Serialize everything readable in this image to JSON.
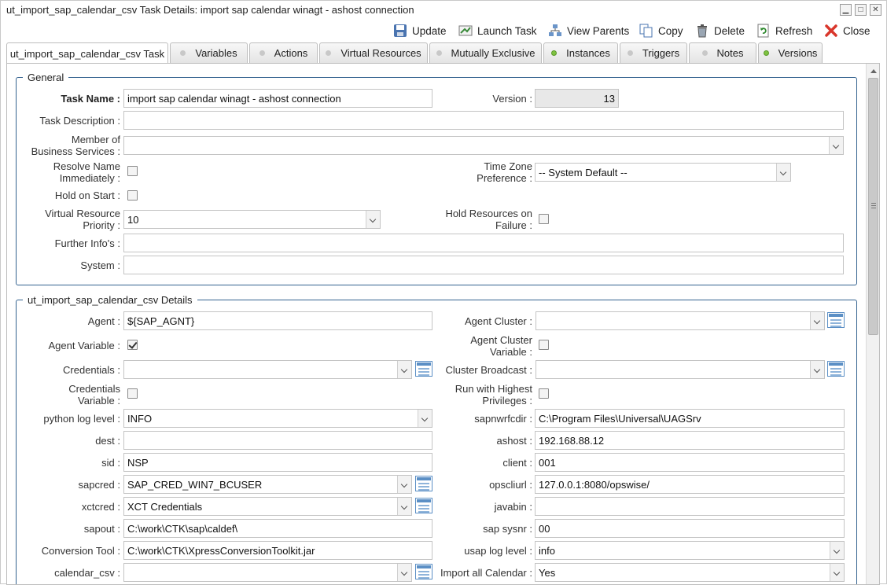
{
  "window": {
    "title": "ut_import_sap_calendar_csv Task Details: import sap calendar winagt - ashost connection",
    "controls": [
      "minimize",
      "maximize",
      "close"
    ]
  },
  "toolbar": {
    "update": "Update",
    "launch": "Launch Task",
    "view_parents": "View Parents",
    "copy": "Copy",
    "delete": "Delete",
    "refresh": "Refresh",
    "close": "Close"
  },
  "tabs": [
    {
      "label": "ut_import_sap_calendar_csv Task",
      "status": "none"
    },
    {
      "label": "Variables",
      "status": "grey"
    },
    {
      "label": "Actions",
      "status": "grey"
    },
    {
      "label": "Virtual Resources",
      "status": "grey"
    },
    {
      "label": "Mutually Exclusive",
      "status": "grey"
    },
    {
      "label": "Instances",
      "status": "green"
    },
    {
      "label": "Triggers",
      "status": "grey"
    },
    {
      "label": "Notes",
      "status": "grey"
    },
    {
      "label": "Versions",
      "status": "green"
    }
  ],
  "general": {
    "legend": "General",
    "task_name_label": "Task Name :",
    "task_name": "import sap calendar winagt - ashost connection",
    "version_label": "Version :",
    "version": "13",
    "task_description_label": "Task Description :",
    "task_description": "",
    "member_label_1": "Member of",
    "member_label_2": "Business Services :",
    "member_value": "",
    "resolve_label_1": "Resolve Name",
    "resolve_label_2": "Immediately :",
    "resolve_checked": false,
    "tz_label_1": "Time Zone",
    "tz_label_2": "Preference :",
    "tz_value": "-- System Default --",
    "hold_label": "Hold on Start :",
    "hold_checked": false,
    "vr_priority_label_1": "Virtual Resource",
    "vr_priority_label_2": "Priority :",
    "vr_priority": "10",
    "hold_res_label_1": "Hold Resources on",
    "hold_res_label_2": "Failure :",
    "hold_res_checked": false,
    "further_info_label": "Further Info's :",
    "further_info": "",
    "system_label": "System :",
    "system": ""
  },
  "details": {
    "legend": "ut_import_sap_calendar_csv Details",
    "agent_label": "Agent :",
    "agent": "${SAP_AGNT}",
    "agent_cluster_label": "Agent Cluster :",
    "agent_cluster": "",
    "agent_variable_label": "Agent Variable :",
    "agent_variable_checked": true,
    "agent_cluster_var_label_1": "Agent Cluster",
    "agent_cluster_var_label_2": "Variable :",
    "agent_cluster_var_checked": false,
    "credentials_label": "Credentials :",
    "credentials": "",
    "cluster_broadcast_label": "Cluster Broadcast :",
    "cluster_broadcast": "",
    "credentials_var_label_1": "Credentials",
    "credentials_var_label_2": "Variable :",
    "credentials_var_checked": false,
    "run_highest_label_1": "Run with Highest",
    "run_highest_label_2": "Privileges :",
    "run_highest_checked": false,
    "python_log_label": "python log level :",
    "python_log": "INFO",
    "sapnwrfcdir_label": "sapnwrfcdir :",
    "sapnwrfcdir": "C:\\Program Files\\Universal\\UAGSrv",
    "dest_label": "dest :",
    "dest": "",
    "ashost_label": "ashost :",
    "ashost": "192.168.88.12",
    "sid_label": "sid :",
    "sid": "NSP",
    "client_label": "client :",
    "client": "001",
    "sapcred_label": "sapcred :",
    "sapcred": "SAP_CRED_WIN7_BCUSER",
    "opscliurl_label": "opscliurl :",
    "opscliurl": "127.0.0.1:8080/opswise/",
    "xctcred_label": "xctcred :",
    "xctcred": "XCT Credentials",
    "javabin_label": "javabin :",
    "javabin": "",
    "sapout_label": "sapout :",
    "sapout": "C:\\work\\CTK\\sap\\caldef\\",
    "sap_sysnr_label": "sap sysnr :",
    "sap_sysnr": "00",
    "conversion_tool_label": "Conversion Tool :",
    "conversion_tool": "C:\\work\\CTK\\XpressConversionToolkit.jar",
    "usap_log_label": "usap log level :",
    "usap_log": "info",
    "calendar_csv_label": "calendar_csv :",
    "calendar_csv": "",
    "import_all_label": "Import all Calendar :",
    "import_all": "Yes"
  },
  "colors": {
    "fieldset_border": "#34628f",
    "status_green": "#7fc241",
    "status_grey": "#c8c8c8",
    "close_red": "#d9362b"
  }
}
